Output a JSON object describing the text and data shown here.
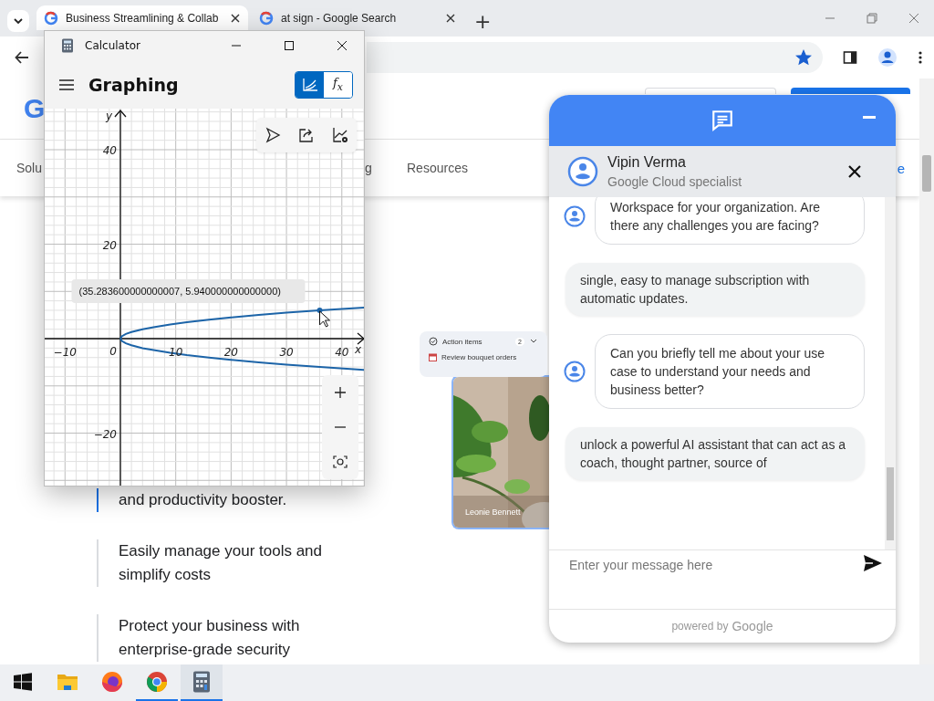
{
  "browser": {
    "tabs": [
      {
        "title": "Business Streamlining & Collab",
        "selected": true
      },
      {
        "title": "at sign - Google Search",
        "selected": false
      }
    ],
    "new_tab": "+",
    "bookmarked": true
  },
  "page": {
    "logo": "G",
    "nav": [
      "Solu",
      "g",
      "Resources"
    ],
    "nav_link": "e",
    "features": [
      {
        "text": "and productivity booster.",
        "selected": true
      },
      {
        "text": "Easily manage your tools and simplify costs",
        "selected": false
      },
      {
        "text": "Protect your business with enterprise-grade security",
        "selected": false
      }
    ],
    "action_card": {
      "title": "Action items",
      "count": "2",
      "task": "Review bouquet orders"
    },
    "photo": {
      "kind": "picture",
      "caption": "Leonie Bennett"
    }
  },
  "calculator": {
    "title": "Calculator",
    "mode": "Graphing",
    "view_buttons": [
      {
        "kind": "graph",
        "selected": true
      },
      {
        "kind": "functions",
        "label": "f$_{x}$",
        "selected": false
      }
    ],
    "chart_data": {
      "type": "line",
      "xlabel": "x",
      "ylabel": "y",
      "x": [
        0,
        0.25,
        1,
        2,
        4,
        6,
        9,
        12,
        16,
        20,
        25,
        30,
        36,
        44
      ],
      "series": [
        {
          "color": "#1c64a8",
          "values": [
            0,
            0.5,
            1,
            1.4,
            2,
            2.4,
            3,
            3.5,
            4,
            4.5,
            5,
            5.5,
            6,
            6.6
          ]
        },
        {
          "color": "#1c64a8",
          "values": [
            0,
            -0.5,
            -1,
            -1.4,
            -2,
            -2.4,
            -3,
            -3.5,
            -4,
            -4.5,
            -5,
            -5.5,
            -6,
            -6.6
          ]
        }
      ],
      "xlim": [
        -13.67,
        44.32
      ],
      "ylim": [
        -31.3,
        48.7
      ],
      "xticks": [
        {
          "value": -10,
          "label": "−10"
        },
        10,
        20,
        30,
        40
      ],
      "yticks": [
        {
          "value": -20,
          "label": "−20"
        },
        20,
        40
      ],
      "annotations": [
        "(35.283600000000007, 5.940000000000000)"
      ],
      "grid": true
    },
    "origin_label": "0"
  },
  "chat": {
    "agent": {
      "name": "Vipin Verma",
      "role": "Google Cloud specialist"
    },
    "messages": [
      {
        "kind": "agent",
        "text": "Workspace for your organization. Are there any challenges you are facing?"
      },
      {
        "kind": "user",
        "text": "single, easy to manage subscription with automatic updates."
      },
      {
        "kind": "agent",
        "text": "Can you briefly tell me about your use case to understand your needs and business better?"
      },
      {
        "kind": "user",
        "text": "unlock a powerful AI assistant that can act as a coach, thought partner, source of"
      }
    ],
    "placeholder": "Enter your message here",
    "powered_by": "powered by",
    "brand": "Google"
  },
  "taskbar": {
    "apps": [
      {
        "kind": "start",
        "running": false,
        "selected": false
      },
      {
        "kind": "files",
        "running": false,
        "selected": false
      },
      {
        "kind": "firefox",
        "running": false,
        "selected": false
      },
      {
        "kind": "chrome",
        "running": true,
        "selected": false
      },
      {
        "kind": "calculator",
        "running": true,
        "selected": true
      }
    ]
  }
}
